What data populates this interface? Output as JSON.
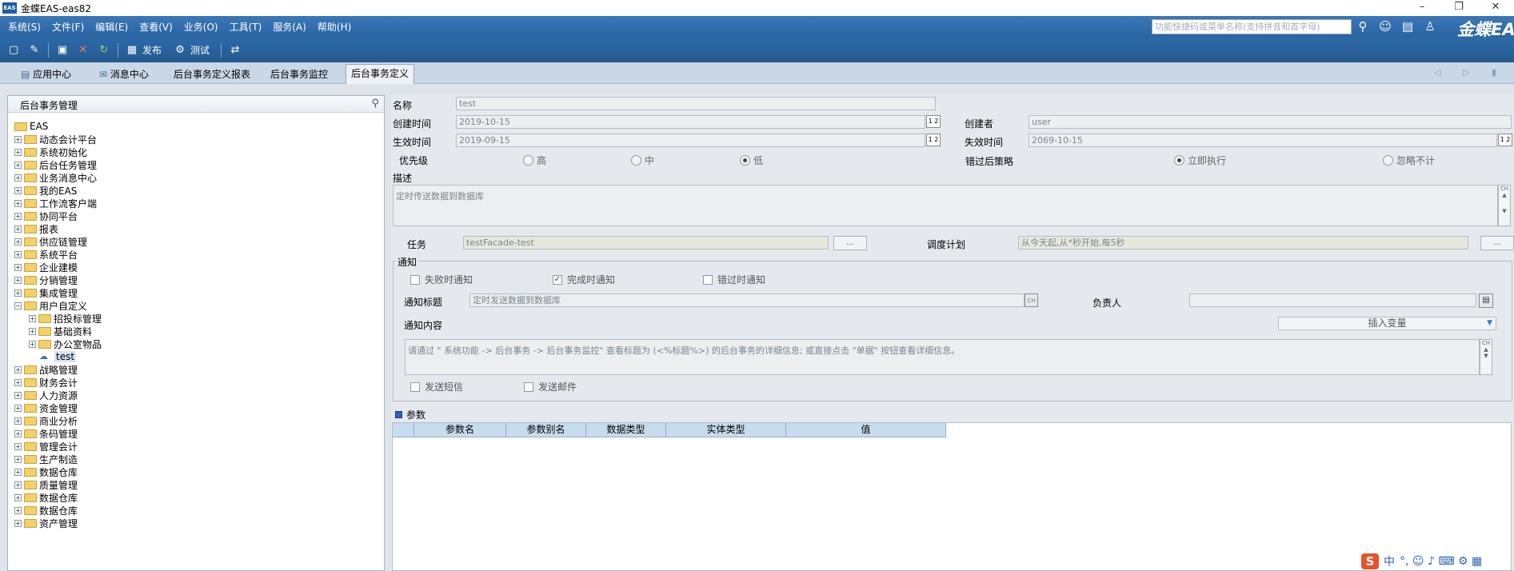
{
  "window": {
    "title": "金蝶EAS-eas82",
    "logo": "EAS",
    "minimize": "–",
    "restore": "❐",
    "close": "✕"
  },
  "menubar": {
    "items": [
      "系统(S)",
      "文件(F)",
      "编辑(E)",
      "查看(V)",
      "业务(O)",
      "工具(T)",
      "服务(A)",
      "帮助(H)"
    ],
    "search_placeholder": "功能快捷码或菜单名称(支持拼音和首字母)",
    "icons": [
      "search-icon",
      "smile-icon",
      "message-icon",
      "user-icon"
    ],
    "brand": "金蝶EAS"
  },
  "toolbar": {
    "publish_label": "发布",
    "test_label": "测试",
    "icons": [
      "new-icon",
      "edit-icon",
      "save-icon",
      "delete-icon",
      "refresh-icon",
      "publish-icon",
      "test-icon",
      "export-icon"
    ]
  },
  "tabs": {
    "items": [
      "应用中心",
      "消息中心",
      "后台事务定义报表",
      "后台事务监控",
      "后台事务定义"
    ],
    "active": "后台事务定义",
    "arrows": "◁ ▷ ▮"
  },
  "tree": {
    "title": "后台事务管理",
    "root": "EAS",
    "nodes": [
      {
        "label": "动态会计平台",
        "level": 1
      },
      {
        "label": "系统初始化",
        "level": 1
      },
      {
        "label": "后台任务管理",
        "level": 1
      },
      {
        "label": "业务消息中心",
        "level": 1
      },
      {
        "label": "我的EAS",
        "level": 1
      },
      {
        "label": "工作流客户端",
        "level": 1
      },
      {
        "label": "协同平台",
        "level": 1
      },
      {
        "label": "报表",
        "level": 1
      },
      {
        "label": "供应链管理",
        "level": 1
      },
      {
        "label": "系统平台",
        "level": 1
      },
      {
        "label": "企业建模",
        "level": 1
      },
      {
        "label": "分销管理",
        "level": 1
      },
      {
        "label": "集成管理",
        "level": 1
      },
      {
        "label": "用户自定义",
        "level": 1,
        "expanded": true
      },
      {
        "label": "招投标管理",
        "level": 2
      },
      {
        "label": "基础资料",
        "level": 2
      },
      {
        "label": "办公室物品",
        "level": 2
      },
      {
        "label": "test",
        "level": 2,
        "leaf": true
      },
      {
        "label": "战略管理",
        "level": 1
      },
      {
        "label": "财务会计",
        "level": 1
      },
      {
        "label": "人力资源",
        "level": 1
      },
      {
        "label": "资金管理",
        "level": 1
      },
      {
        "label": "商业分析",
        "level": 1
      },
      {
        "label": "条码管理",
        "level": 1
      },
      {
        "label": "管理会计",
        "level": 1
      },
      {
        "label": "生产制造",
        "level": 1
      },
      {
        "label": "数据仓库",
        "level": 1
      },
      {
        "label": "质量管理",
        "level": 1
      },
      {
        "label": "数据仓库",
        "level": 1
      },
      {
        "label": "数据仓库",
        "level": 1
      },
      {
        "label": "资产管理",
        "level": 1
      }
    ]
  },
  "form": {
    "name_label": "名称",
    "name_value": "test",
    "created_label": "创建时间",
    "created_value": "2019-10-15",
    "creator_label": "创建者",
    "creator_value": "user",
    "effective_label": "生效时间",
    "effective_value": "2019-09-15",
    "expire_label": "失效时间",
    "expire_value": "2069-10-15",
    "spin_text": "1 2",
    "priority_label": "优先级",
    "priority_options": [
      "高",
      "中",
      "低"
    ],
    "priority_selected": "低",
    "missed_label": "错过后策略",
    "missed_options": [
      "立即执行",
      "忽略不计"
    ],
    "missed_selected": "立即执行",
    "desc_label": "描述",
    "desc_value": "定时传送数据到数据库",
    "task_label": "任务",
    "task_value": "testFacade-test",
    "schedule_label": "调度计划",
    "schedule_value": "从今天起,从*秒开始,每5秒",
    "dots": "...",
    "ch": "CH"
  },
  "notify": {
    "group_label": "通知",
    "on_fail": "失败时通知",
    "on_complete": "完成时通知",
    "on_miss": "错过时通知",
    "title_label": "通知标题",
    "title_value": "定时发送数据到数据库",
    "owner_label": "负责人",
    "owner_value": "",
    "content_label": "通知内容",
    "insert_var": "插入变量",
    "content_value": "请通过 \" 系统功能 -> 后台事务 -> 后台事务监控\" 查看标题为 (<%标题%>) 的后台事务的详细信息; 或直接点击 \"单据\" 按钮查看详细信息。",
    "send_sms": "发送短信",
    "send_mail": "发送邮件"
  },
  "params": {
    "tab_label": "参数",
    "columns": [
      "参数名",
      "参数别名",
      "数据类型",
      "实体类型",
      "值"
    ]
  },
  "ime": {
    "logo": "S",
    "lang": "中",
    "extras": "°, ☺ ♪ ⌨ ⚙ ▦"
  },
  "colors": {
    "menubar": "#2a64a2",
    "accent": "#3a78b8",
    "grid_header": "#c6dcef"
  }
}
